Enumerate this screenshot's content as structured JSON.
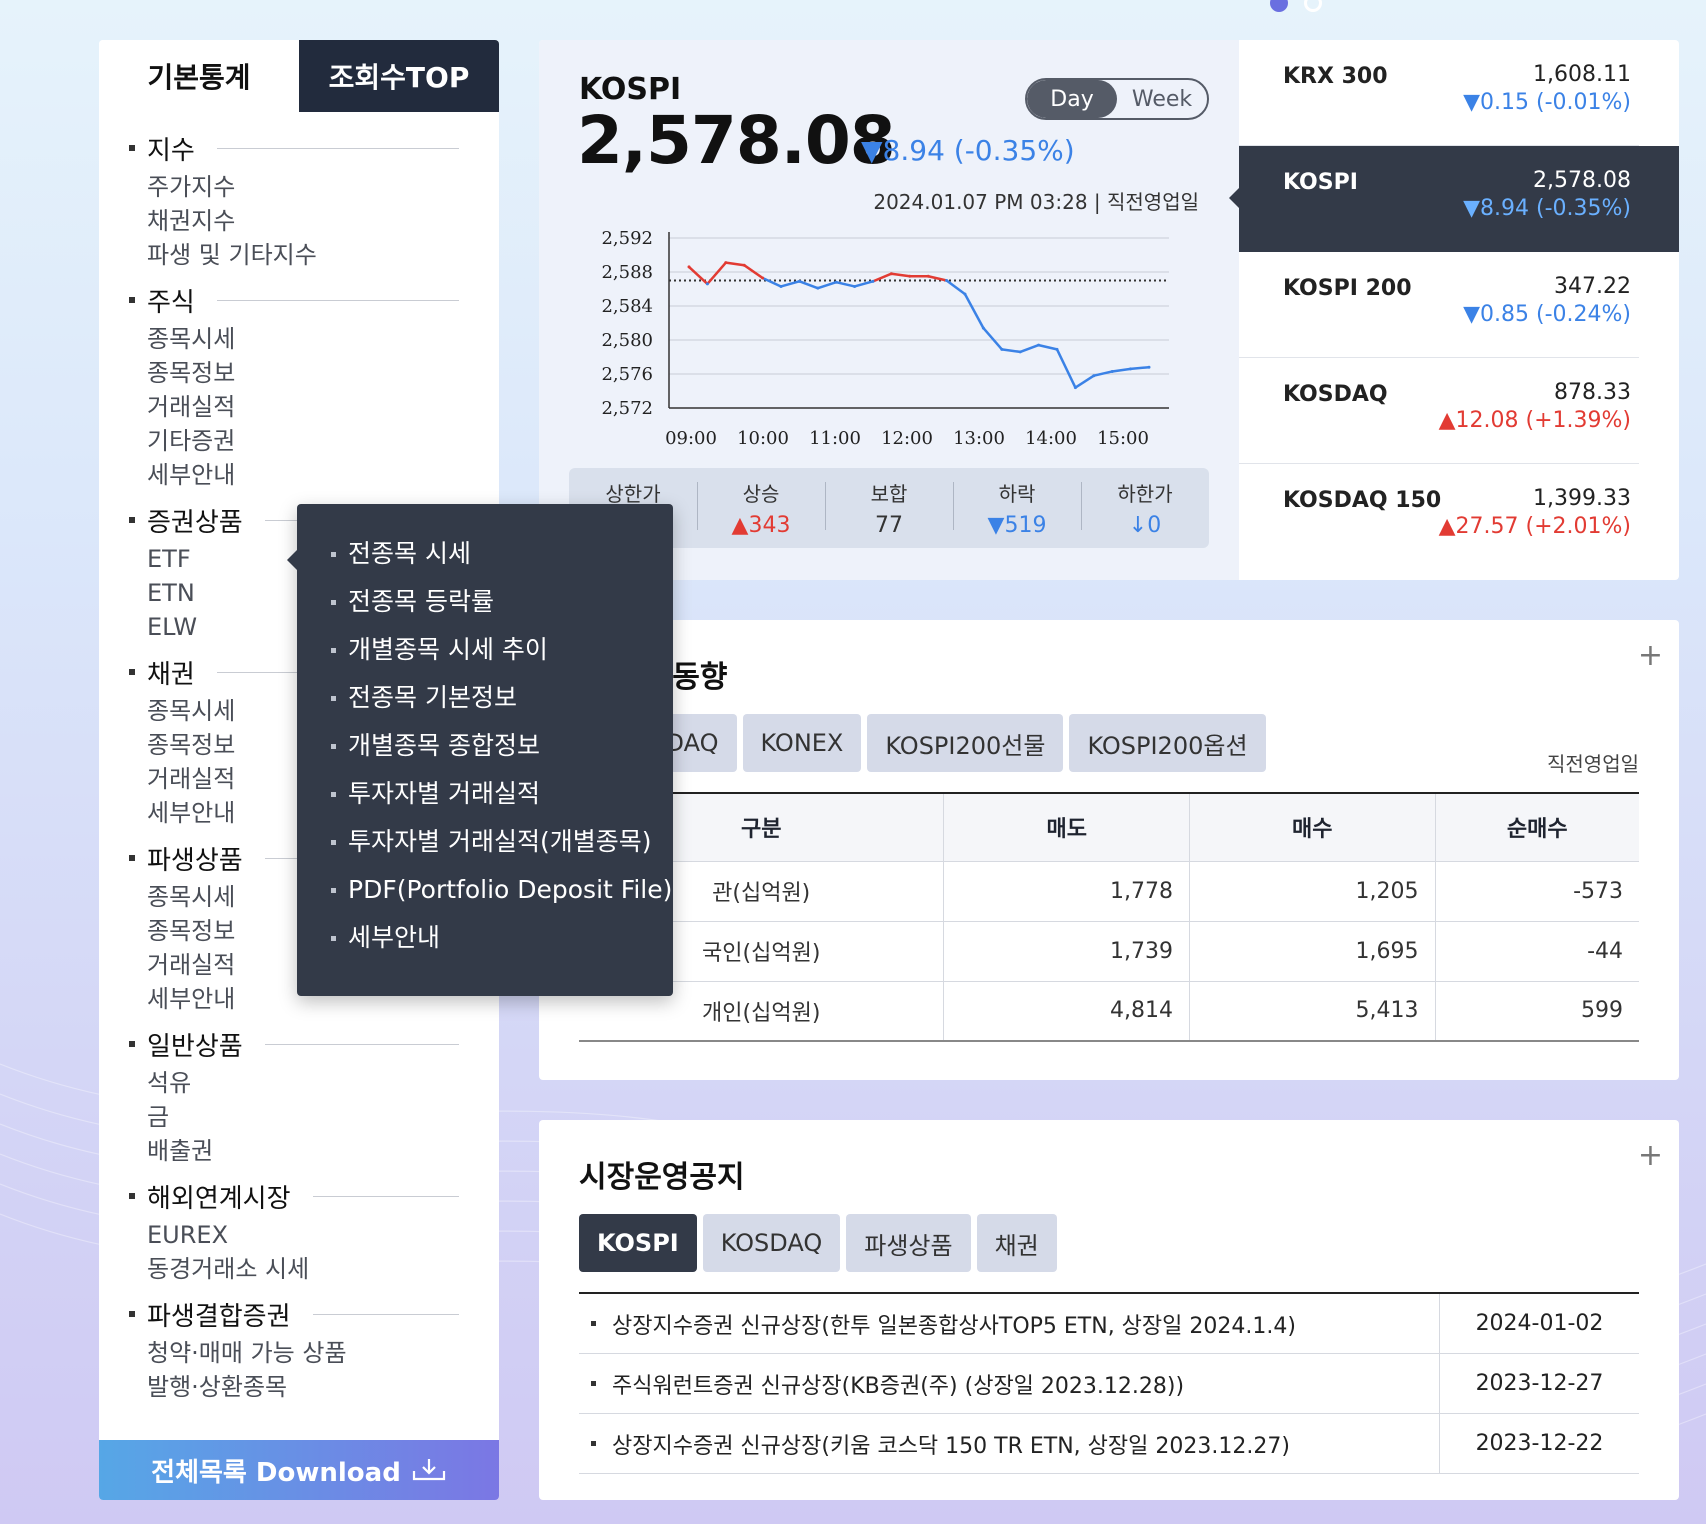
{
  "left_panel": {
    "tabs": [
      "기본통계",
      "조회수TOP"
    ],
    "groups": [
      {
        "title": "지수",
        "items": [
          "주가지수",
          "채권지수",
          "파생 및 기타지수"
        ]
      },
      {
        "title": "주식",
        "items": [
          "종목시세",
          "종목정보",
          "거래실적",
          "기타증권",
          "세부안내"
        ]
      },
      {
        "title": "증권상품",
        "items": [
          "ETF",
          "ETN",
          "ELW"
        ]
      },
      {
        "title": "채권",
        "items": [
          "종목시세",
          "종목정보",
          "거래실적",
          "세부안내"
        ]
      },
      {
        "title": "파생상품",
        "items": [
          "종목시세",
          "종목정보",
          "거래실적",
          "세부안내"
        ]
      },
      {
        "title": "일반상품",
        "items": [
          "석유",
          "금",
          "배출권"
        ]
      },
      {
        "title": "해외연계시장",
        "items": [
          "EUREX",
          "동경거래소 시세"
        ]
      },
      {
        "title": "파생결합증권",
        "items": [
          "청약·매매 가능 상품",
          "발행·상환종목"
        ]
      }
    ],
    "download_label": "전체목록 Download"
  },
  "popup_menu": {
    "parent": "ETF",
    "items": [
      "전종목 시세",
      "전종목 등락률",
      "개별종목 시세 추이",
      "전종목 기본정보",
      "개별종목 종합정보",
      "투자자별 거래실적",
      "투자자별 거래실적(개별종목)",
      "PDF(Portfolio Deposit File)",
      "세부안내"
    ]
  },
  "index_summary": {
    "name": "KOSPI",
    "value": "2,578.08",
    "change": "▼8.94 (-0.35%)",
    "toggle": {
      "day": "Day",
      "week": "Week",
      "selected": "Day"
    },
    "timestamp": "2024.01.07 PM 03:28 | 직전영업일",
    "breadth": [
      {
        "label": "상한가",
        "value": ""
      },
      {
        "label": "상승",
        "value": "▲343"
      },
      {
        "label": "보합",
        "value": "77"
      },
      {
        "label": "하락",
        "value": "▼519"
      },
      {
        "label": "하한가",
        "value": "↓0"
      }
    ]
  },
  "chart_data": {
    "type": "line",
    "x": [
      "09:00",
      "09:15",
      "09:30",
      "09:45",
      "10:00",
      "10:15",
      "10:30",
      "10:45",
      "11:00",
      "11:15",
      "11:30",
      "11:45",
      "12:00",
      "12:15",
      "12:30",
      "12:45",
      "13:00",
      "13:15",
      "13:30",
      "13:45",
      "14:00",
      "14:15",
      "14:30",
      "14:45",
      "15:00",
      "15:15"
    ],
    "series": [
      {
        "values": [
          2588.6,
          2586.6,
          2589.1,
          2588.8,
          2587.3,
          2586.3,
          2586.9,
          2586.1,
          2586.8,
          2586.3,
          2586.9,
          2587.8,
          2587.5,
          2587.5,
          2587.0,
          2585.4,
          2581.4,
          2578.9,
          2578.6,
          2579.4,
          2578.9,
          2574.4,
          2575.8,
          2576.3,
          2576.6,
          2576.8
        ]
      }
    ],
    "reference_value": 2587.0,
    "yticks": [
      "2,592",
      "2,588",
      "2,584",
      "2,580",
      "2,576",
      "2,572"
    ],
    "ylim": [
      2572,
      2592
    ],
    "xticks": [
      "09:00",
      "10:00",
      "11:00",
      "12:00",
      "13:00",
      "14:00",
      "15:00"
    ],
    "colors": {
      "above": "#e23b33",
      "below": "#3b82e6",
      "reference": "#333333"
    },
    "grid": true
  },
  "index_list": [
    {
      "name": "KRX 300",
      "value": "1,608.11",
      "change": "▼0.15 (-0.01%)",
      "dir": "down"
    },
    {
      "name": "KOSPI",
      "value": "2,578.08",
      "change": "▼8.94 (-0.35%)",
      "dir": "down",
      "active": true
    },
    {
      "name": "KOSPI 200",
      "value": "347.22",
      "change": "▼0.85 (-0.24%)",
      "dir": "down"
    },
    {
      "name": "KOSDAQ",
      "value": "878.33",
      "change": "▲12.08 (+1.39%)",
      "dir": "up"
    },
    {
      "name": "KOSDAQ 150",
      "value": "1,399.33",
      "change": "▲27.57 (+2.01%)",
      "dir": "up"
    }
  ],
  "trading": {
    "title": "별 매매동향",
    "tabs": [
      "KOSDAQ",
      "KONEX",
      "KOSPI200선물",
      "KOSPI200옵션"
    ],
    "note": "직전영업일",
    "headers": [
      "구분",
      "매도",
      "매수",
      "순매수"
    ],
    "rows": [
      [
        "관(십억원)",
        "1,778",
        "1,205",
        "-573"
      ],
      [
        "국인(십억원)",
        "1,739",
        "1,695",
        "-44"
      ],
      [
        "개인(십억원)",
        "4,814",
        "5,413",
        "599"
      ]
    ]
  },
  "notices": {
    "title": "시장운영공지",
    "tabs": [
      "KOSPI",
      "KOSDAQ",
      "파생상품",
      "채권"
    ],
    "items": [
      {
        "title": "상장지수증권 신규상장(한투 일본종합상사TOP5 ETN, 상장일 2024.1.4)",
        "date": "2024-01-02"
      },
      {
        "title": "주식워런트증권 신규상장(KB증권(주) (상장일 2023.12.28))",
        "date": "2023-12-27"
      },
      {
        "title": "상장지수증권 신규상장(키움 코스닥 150 TR ETN, 상장일 2023.12.27)",
        "date": "2023-12-22"
      }
    ]
  }
}
